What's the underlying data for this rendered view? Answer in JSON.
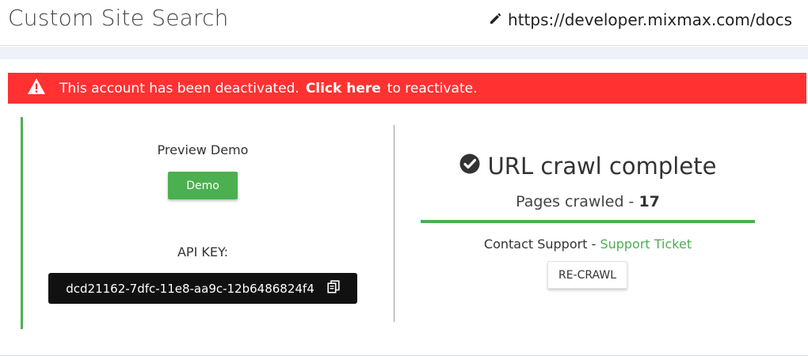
{
  "header": {
    "title": "Custom Site Search",
    "url": "https://developer.mixmax.com/docs",
    "edit_icon": "pencil-icon"
  },
  "alert": {
    "icon": "warning-triangle-icon",
    "message": "This account has been deactivated.",
    "link_label": "Click here",
    "suffix": "to reactivate.",
    "background": "#ff3131"
  },
  "left_panel": {
    "preview_label": "Preview Demo",
    "demo_button_label": "Demo",
    "api_key_label": "API KEY:",
    "api_key_value": "dcd21162-7dfc-11e8-aa9c-12b6486824f4",
    "copy_icon": "copy-icon"
  },
  "right_panel": {
    "status_icon": "check-circle-icon",
    "status_title": "URL crawl complete",
    "pages_crawled_label": "Pages crawled -",
    "pages_crawled_count": "17",
    "progress_fraction": 1.0,
    "support_label": "Contact Support -",
    "support_link": "Support Ticket",
    "recrawl_button_label": "RE-CRAWL"
  },
  "colors": {
    "accent_green": "#4caf50",
    "alert_red": "#ff3131",
    "key_box": "#111111"
  }
}
